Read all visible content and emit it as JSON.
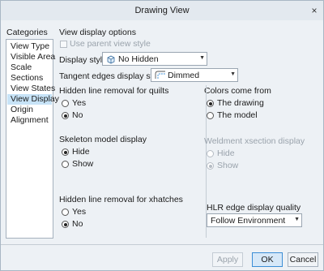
{
  "window": {
    "title": "Drawing View",
    "close": "×"
  },
  "categories": {
    "label": "Categories",
    "items": [
      "View Type",
      "Visible Area",
      "Scale",
      "Sections",
      "View States",
      "View Display",
      "Origin",
      "Alignment"
    ],
    "selected": "View Display"
  },
  "options": {
    "heading": "View display options",
    "use_parent": "Use parent view style",
    "display_style_label": "Display style",
    "display_style_value": "No Hidden",
    "tangent_label": "Tangent edges display style",
    "tangent_value": "Dimmed"
  },
  "hidden_quilts": {
    "label": "Hidden line removal for quilts",
    "yes": "Yes",
    "no": "No",
    "selected": "No"
  },
  "colors_from": {
    "label": "Colors come from",
    "drawing": "The drawing",
    "model": "The model",
    "selected": "The drawing"
  },
  "skeleton": {
    "label": "Skeleton model display",
    "hide": "Hide",
    "show": "Show",
    "selected": "Hide"
  },
  "weldment": {
    "label": "Weldment xsection display",
    "hide": "Hide",
    "show": "Show",
    "selected": "Show"
  },
  "hidden_xhatches": {
    "label": "Hidden line removal for xhatches",
    "yes": "Yes",
    "no": "No",
    "selected": "No"
  },
  "hlr": {
    "label": "HLR edge display quality",
    "value": "Follow Environment"
  },
  "buttons": {
    "apply": "Apply",
    "ok": "OK",
    "cancel": "Cancel"
  },
  "icons": {
    "display_style": "cube-icon",
    "tangent": "tangent-edge-icon",
    "close": "close-icon"
  },
  "colors": {
    "dialog_bg": "#edf1f5",
    "selection": "#c7e3f7",
    "accent": "#3b8ed6"
  }
}
